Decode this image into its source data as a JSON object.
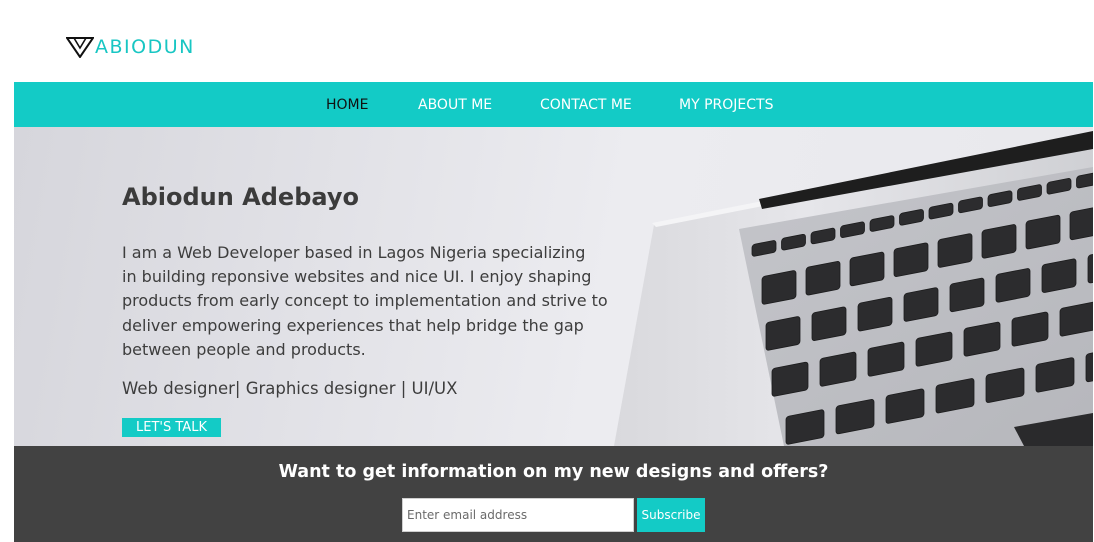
{
  "brand": {
    "logo_icon": "triangle-logo-icon",
    "name": "ABIODUN"
  },
  "nav": {
    "items": [
      {
        "label": "HOME",
        "active": true
      },
      {
        "label": "ABOUT ME",
        "active": false
      },
      {
        "label": "CONTACT ME",
        "active": false
      },
      {
        "label": "MY PROJECTS",
        "active": false
      }
    ]
  },
  "hero": {
    "name": "Abiodun Adebayo",
    "bio_lines": [
      "I am a Web Developer based in Lagos Nigeria specializing",
      "in building reponsive websites and nice UI. I enjoy shaping",
      "products from early concept to implementation and strive to",
      "deliver empowering experiences that help bridge the gap",
      "between people and products."
    ],
    "roles": "Web designer| Graphics designer | UI/UX",
    "cta_label": "LET'S TALK",
    "background_image": "laptop-keyboard-photo"
  },
  "newsletter": {
    "title": "Want to get information on my new designs and offers?",
    "email_placeholder": "Enter email address",
    "subscribe_label": "Subscribe"
  },
  "colors": {
    "accent": "#13cbc6",
    "nav_active_text": "#111111",
    "footer_bg": "#424242"
  }
}
